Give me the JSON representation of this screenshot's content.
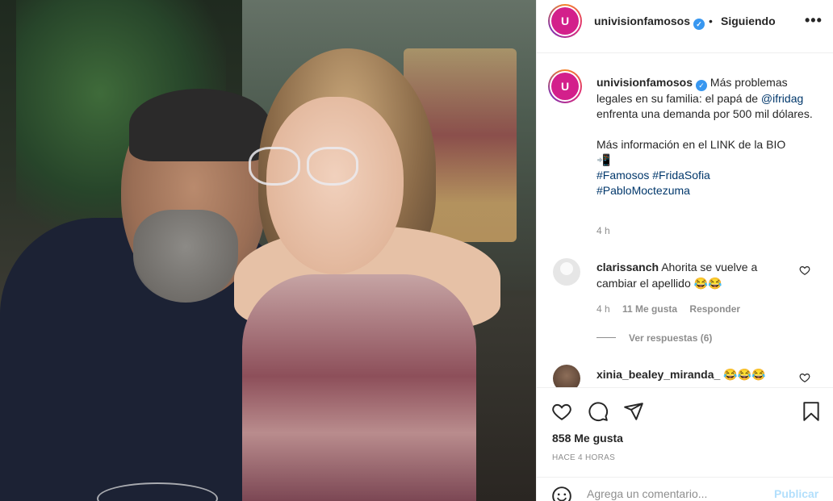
{
  "header": {
    "avatar_letter": "U",
    "username": "univisionfamosos",
    "separator": "•",
    "follow_status": "Siguiendo",
    "more": "•••"
  },
  "caption": {
    "username": "univisionfamosos",
    "text_part1": "Más problemas legales en su familia: el papá de ",
    "mention": "@ifridag",
    "text_part2": " enfrenta una demanda por 500 mil dólares.",
    "text_part3": "Más información en el LINK de la BIO",
    "emoji": "📲",
    "hashtags": [
      "#Famosos",
      "#FridaSofia",
      "#PabloMoctezuma"
    ],
    "time": "4 h"
  },
  "comments": [
    {
      "username": "clarissanch",
      "text": "Ahorita se vuelve a cambiar el apellido 😂😂",
      "time": "4 h",
      "likes": "11 Me gusta",
      "reply": "Responder",
      "view_replies": "Ver respuestas (6)"
    },
    {
      "username": "xinia_bealey_miranda_",
      "text": "😂😂😂"
    }
  ],
  "actions": {
    "likes": "858 Me gusta",
    "timestamp": "HACE 4 HORAS",
    "comment_placeholder": "Agrega un comentario...",
    "post_label": "Publicar"
  },
  "icons": {
    "verified": "verified-badge-icon",
    "like": "heart-icon",
    "comment": "comment-bubble-icon",
    "share": "paper-plane-icon",
    "save": "bookmark-icon",
    "emoji": "smiley-icon"
  },
  "colors": {
    "link": "#00376b",
    "verified": "#3897f0",
    "post_disabled": "#b2dffc",
    "brand": "#d3208b"
  }
}
